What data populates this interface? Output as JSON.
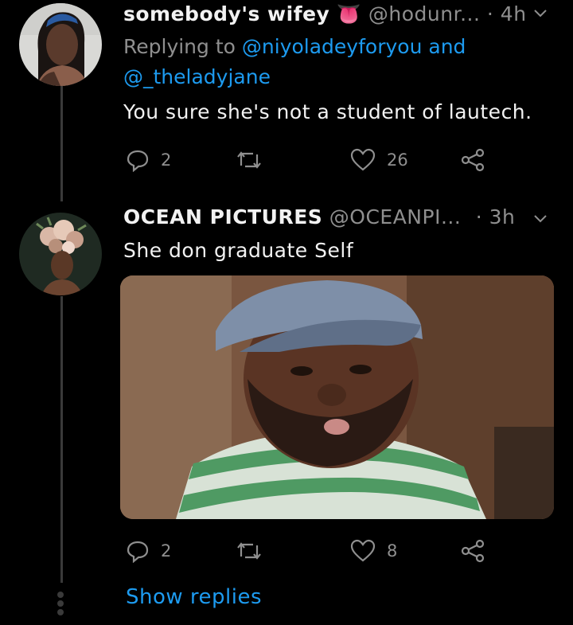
{
  "tweets": [
    {
      "name": "somebody's wifey",
      "emoji": "👅",
      "handle": "@hodunr...",
      "time": "· 4h",
      "replying_label": "Replying to",
      "mention_1": "@niyoladeyforyou",
      "and_text": "and",
      "mention_2": "@_theladyjane",
      "text": "You sure she's not a student of lautech.",
      "replies": "2",
      "likes": "26"
    },
    {
      "name": "OCEAN PICTURES",
      "handle": "@OCEANPI...",
      "time": "· 3h",
      "text": "She don graduate Self",
      "replies": "2",
      "likes": "8"
    }
  ],
  "show_replies": "Show replies",
  "colors": {
    "background": "#000000",
    "accent": "#1d9bf0",
    "muted": "#8f8f8f"
  },
  "icons": [
    "reply-icon",
    "retweet-icon",
    "like-icon",
    "share-icon",
    "chevron-down-icon"
  ]
}
